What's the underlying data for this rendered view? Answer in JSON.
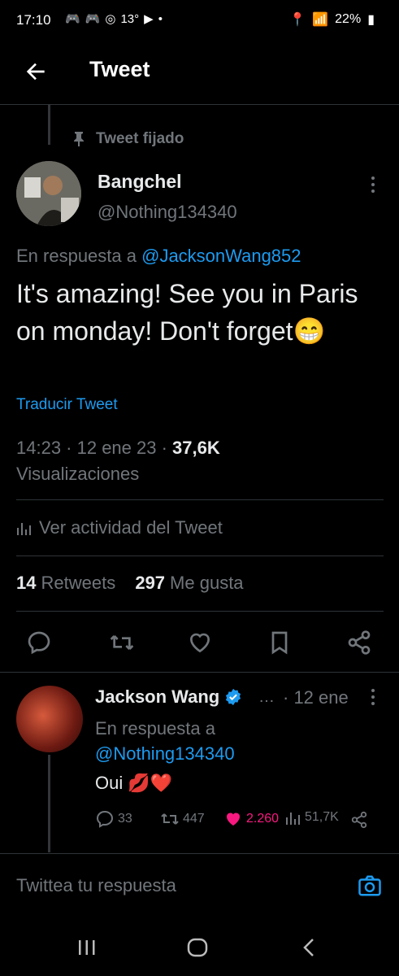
{
  "status_bar": {
    "time": "17:10",
    "temp": "13°",
    "battery": "22%"
  },
  "appbar": {
    "title": "Tweet"
  },
  "pinned_label": "Tweet fijado",
  "tweet": {
    "name": "Bangchel",
    "handle": "@Nothing134340",
    "reply_prefix": "En respuesta a",
    "reply_handle": "@JacksonWang852",
    "text": "It's amazing! See you in Paris on monday! Don't forget",
    "emoji": "😁",
    "translate": "Traducir Tweet",
    "time": "14:23 · 12 ene 23 ·",
    "views_count": "37,6K",
    "views_label": "Visualizaciones",
    "activity": "Ver actividad del Tweet",
    "retweets_count": "14",
    "retweets_label": "Retweets",
    "likes_count": "297",
    "likes_label": "Me gusta"
  },
  "reply": {
    "name": "Jackson Wang",
    "ellipsis": "…",
    "date": "· 12 ene",
    "reply_prefix": "En respuesta a",
    "reply_handle": "@Nothing134340",
    "text": "Oui",
    "emojis": "💋❤️",
    "replies": "33",
    "retweets": "447",
    "likes": "2.260",
    "views": "51,7K"
  },
  "compose": {
    "placeholder": "Twittea tu respuesta"
  },
  "colors": {
    "accent": "#1d9bf0",
    "like": "#f91880",
    "muted": "#71767b"
  }
}
